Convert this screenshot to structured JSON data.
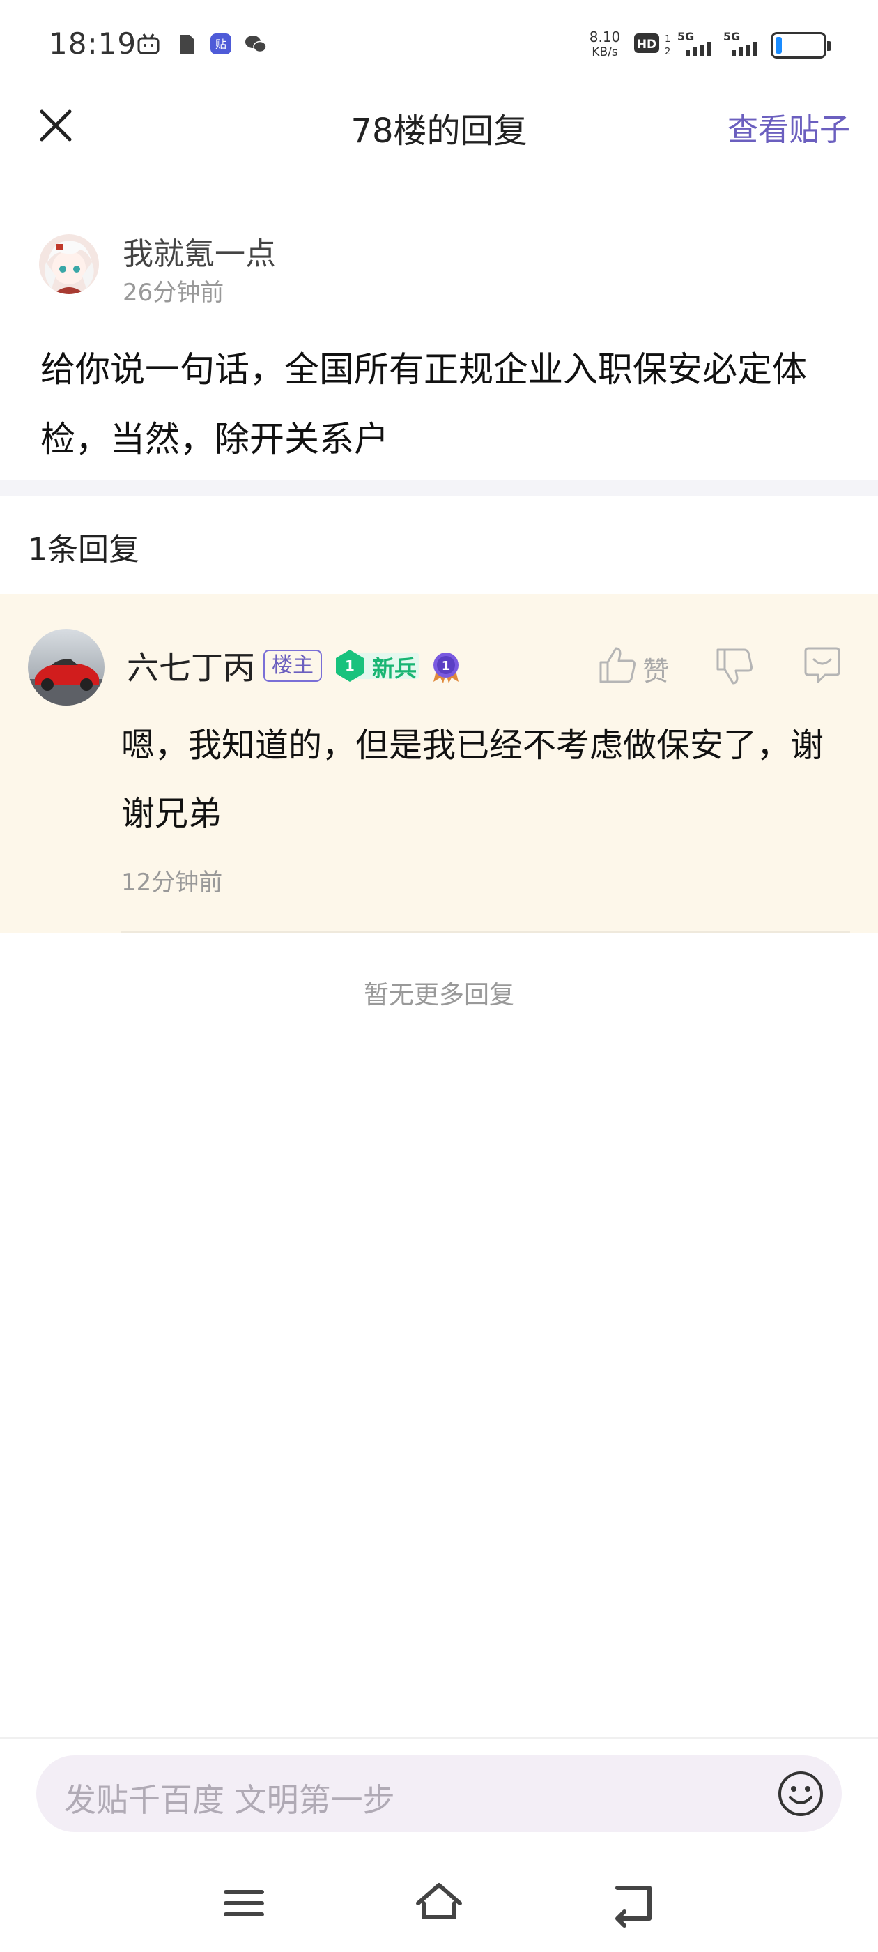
{
  "status_bar": {
    "time": "18:19",
    "net_speed_value": "8.10",
    "net_speed_unit": "KB/s",
    "hd_label": "HD",
    "sim1_label": "5G",
    "sim2_label": "5G"
  },
  "header": {
    "title": "78楼的回复",
    "view_post_label": "查看贴子"
  },
  "post": {
    "username": "我就氪一点",
    "time": "26分钟前",
    "body": "给你说一句话，全国所有正规企业入职保安必定体检，当然，除开关系户"
  },
  "replies_header": {
    "count_label": "1条回复"
  },
  "reply": {
    "username": "六七丁丙",
    "owner_badge": "楼主",
    "level_number": "1",
    "level_title": "新兵",
    "medal_number": "1",
    "like_label": "赞",
    "text": "嗯，我知道的，但是我已经不考虑做保安了，谢谢兄弟",
    "time": "12分钟前"
  },
  "footer_note": "暂无更多回复",
  "input": {
    "placeholder": "发贴千百度 文明第一步"
  },
  "colors": {
    "accent": "#6b5fbf",
    "reply_bg": "#fdf7ea",
    "level_green": "#18b573"
  },
  "icons": {
    "close": "close-icon",
    "like": "thumb-up-icon",
    "dislike": "thumb-down-icon",
    "comment": "comment-icon",
    "emoji": "smiley-icon",
    "nav_menu": "menu-icon",
    "nav_home": "home-icon",
    "nav_back": "back-icon"
  }
}
